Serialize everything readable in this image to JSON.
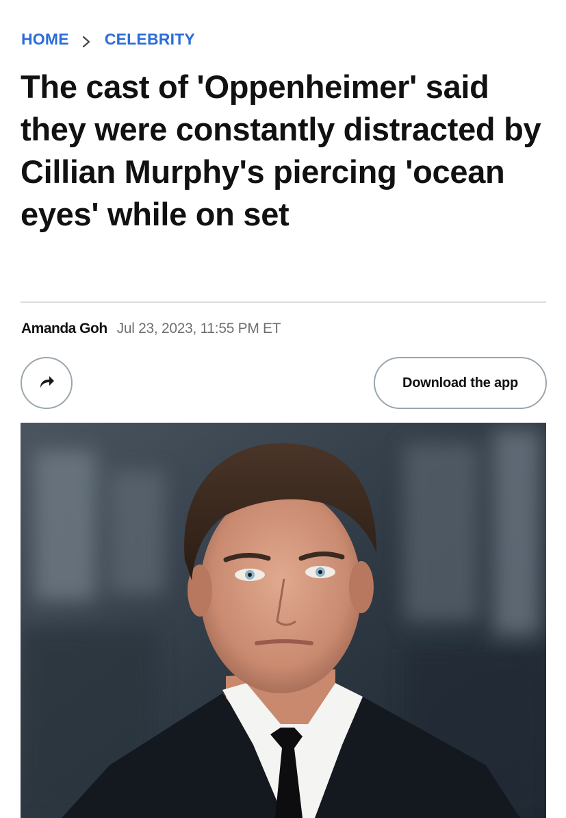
{
  "breadcrumb": {
    "home": "HOME",
    "section": "CELEBRITY"
  },
  "article": {
    "title": "The cast of 'Oppenheimer' said they were constantly distracted by Cillian Murphy's piercing 'ocean eyes' while on set",
    "author": "Amanda Goh",
    "timestamp": "Jul 23, 2023, 11:55 PM ET"
  },
  "actions": {
    "share_icon": "share-arrow-icon",
    "download_label": "Download the app"
  },
  "hero_image": {
    "description_icon": "photo",
    "alt": "Cillian Murphy"
  },
  "colors": {
    "accent": "#2b6cd9",
    "title": "#111111",
    "meta": "#707070",
    "button_border": "#9aa5ad"
  }
}
